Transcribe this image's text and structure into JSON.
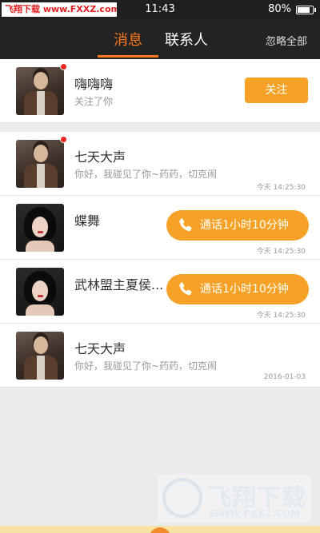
{
  "status_bar": {
    "watermark": "飞翔下载 www.FXXZ.com",
    "time": "11:43",
    "battery": "80%",
    "battery_level": 0.8
  },
  "header": {
    "tabs": [
      {
        "label": "消息",
        "active": true
      },
      {
        "label": "联系人",
        "active": false
      }
    ],
    "ignore_all": "忽略全部",
    "accent_color": "#ff7a1a"
  },
  "follow_notice": {
    "name": "嗨嗨嗨",
    "subtitle": "关注了你",
    "button": "关注",
    "unread": true
  },
  "messages": [
    {
      "name": "七天大声",
      "preview": "你好，我碰见了你~药药，切克闹",
      "time": "今天 14:25:30",
      "unread": true,
      "avatar": "male",
      "call": ""
    },
    {
      "name": "蝶舞",
      "preview": "",
      "time": "今天 14:25:30",
      "unread": false,
      "avatar": "female",
      "call": "通话1小时10分钟"
    },
    {
      "name": "武林盟主夏侯...",
      "preview": "",
      "time": "今天 14:25:30",
      "unread": false,
      "avatar": "female",
      "call": "通话1小时10分钟"
    },
    {
      "name": "七天大声",
      "preview": "你好，我碰见了你~药药，切克闹",
      "time": "2016-01-03",
      "unread": false,
      "avatar": "male",
      "call": ""
    }
  ],
  "footer_watermark": {
    "brand": "飞翔下载",
    "url": "WWW.FXXZ.COM"
  },
  "colors": {
    "button": "#f7a226",
    "unread_dot": "#e8251f",
    "background": "#e9ebed"
  }
}
